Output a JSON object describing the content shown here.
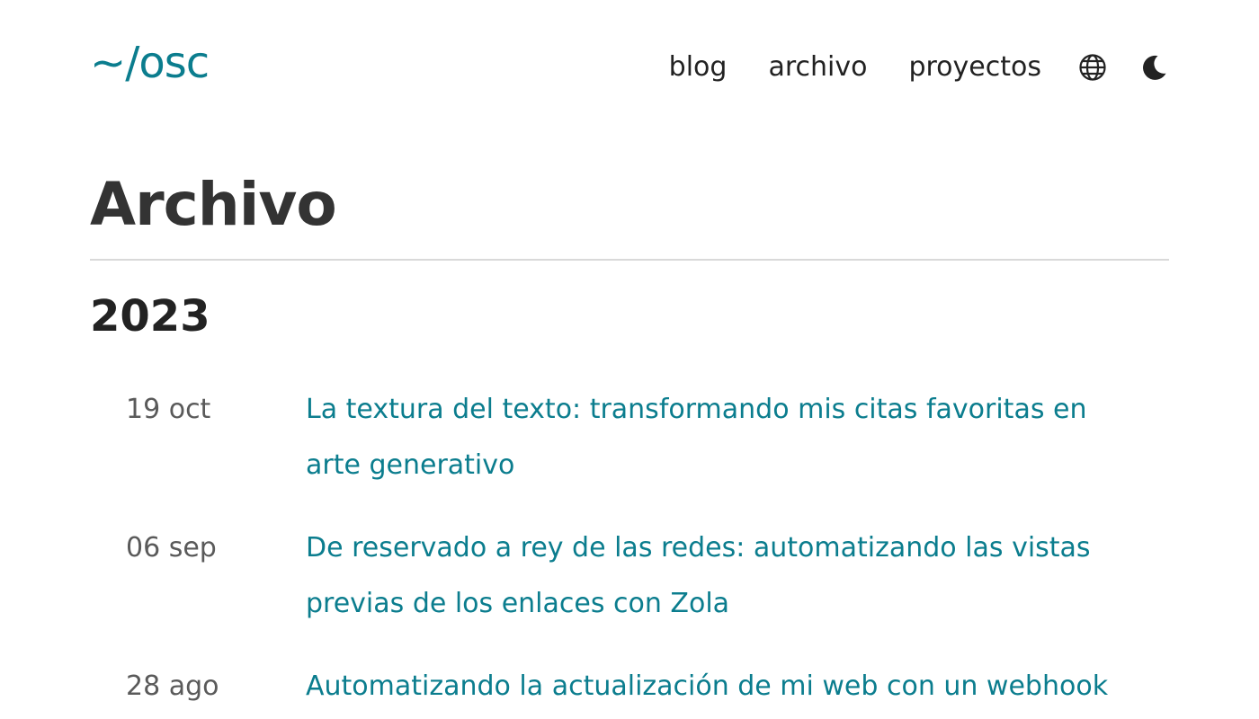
{
  "header": {
    "logo": "~/osc",
    "nav": {
      "blog": "blog",
      "archive": "archivo",
      "projects": "proyectos"
    },
    "icons": [
      "globe-icon",
      "moon-icon"
    ]
  },
  "page": {
    "title": "Archivo",
    "year": "2023"
  },
  "posts": [
    {
      "date": "19 oct",
      "title": "La textura del texto: transformando mis citas favoritas en arte generativo"
    },
    {
      "date": "06 sep",
      "title": "De reservado a rey de las redes: automatizando las vistas previas de los enlaces con Zola"
    },
    {
      "date": "28 ago",
      "title": "Automatizando la actualización de mi web con un webhook"
    }
  ],
  "colors": {
    "accent": "#0b7d8e",
    "text": "#222222",
    "muted": "#5a5a5a",
    "divider": "#d9d9d9"
  }
}
